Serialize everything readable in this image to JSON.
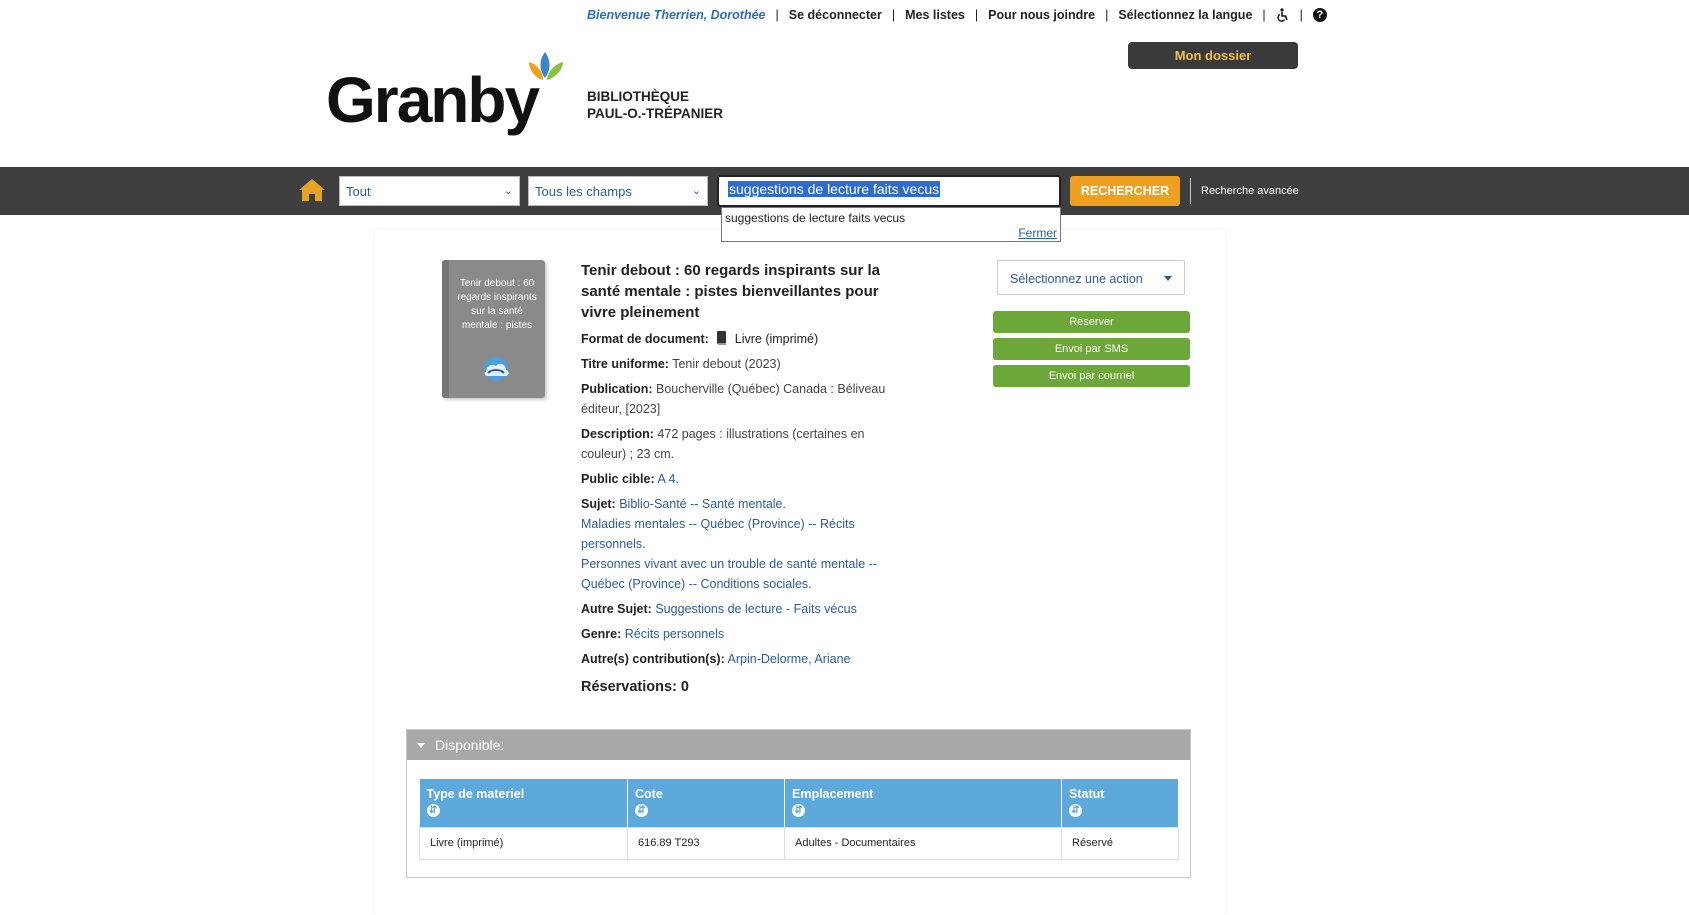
{
  "utility": {
    "welcome": "Bienvenue Therrien, Dorothée",
    "logout": "Se déconnecter",
    "lists": "Mes listes",
    "contact": "Pour nous joindre",
    "language": "Sélectionnez la langue",
    "help": "?"
  },
  "account_button": "Mon dossier",
  "logo": {
    "word": "Granby",
    "line1": "BIBLIOTHÈQUE",
    "line2": "PAUL-O.-TRÉPANIER"
  },
  "search": {
    "scope": "Tout",
    "field": "Tous les champs",
    "query": "suggestions de lecture faits vecus",
    "button": "RECHERCHER",
    "advanced": "Recherche avancée",
    "suggestion": "suggestions de lecture faits vecus",
    "close": "Fermer"
  },
  "record": {
    "cover_text": "Tenir debout : 60 regards inspirants sur la santé mentale : pistes",
    "title": "Tenir debout : 60 regards inspirants sur la santé mentale : pistes bienveillantes pour vivre pleinement",
    "format_label": "Format de document:",
    "format_value": "Livre (imprimé)",
    "uniform_label": "Titre uniforme:",
    "uniform_value": "Tenir debout (2023)",
    "publication_label": "Publication:",
    "publication_value": "Boucherville (Québec) Canada : Béliveau éditeur, [2023]",
    "description_label": "Description:",
    "description_value": "472 pages : illustrations (certaines en couleur) ; 23 cm.",
    "audience_label": "Public cible:",
    "audience_value": "A 4.",
    "subject_label": "Sujet:",
    "subjects": [
      "Biblio-Santé -- Santé mentale.",
      "Maladies mentales -- Québec (Province) -- Récits personnels.",
      "Personnes vivant avec un trouble de santé mentale -- Québec (Province) -- Conditions sociales."
    ],
    "other_subject_label": "Autre Sujet:",
    "other_subject_value": "Suggestions de lecture - Faits vécus",
    "genre_label": "Genre:",
    "genre_value": "Récits personnels",
    "contrib_label": "Autre(s) contribution(s):",
    "contrib_value": "Arpin-Delorme, Ariane",
    "reservations": "Réservations: 0"
  },
  "actions": {
    "select": "Sélectionnez une action",
    "reserve": "Réserver",
    "sms": "Envoi par SMS",
    "email": "Envoi par courriel"
  },
  "availability": {
    "heading": "Disponible:",
    "columns": [
      "Type de materiel",
      "Cote",
      "Emplacement",
      "Statut"
    ],
    "rows": [
      [
        "Livre (imprimé)",
        "616.89 T293",
        "Adultes - Documentaires",
        "Réservé"
      ]
    ]
  },
  "colors": {
    "topbar": "#3e3e3e",
    "search_button": "#f0a020",
    "action_green": "#6ba839",
    "table_header": "#5ea9dc",
    "link": "#2a5d9a"
  }
}
